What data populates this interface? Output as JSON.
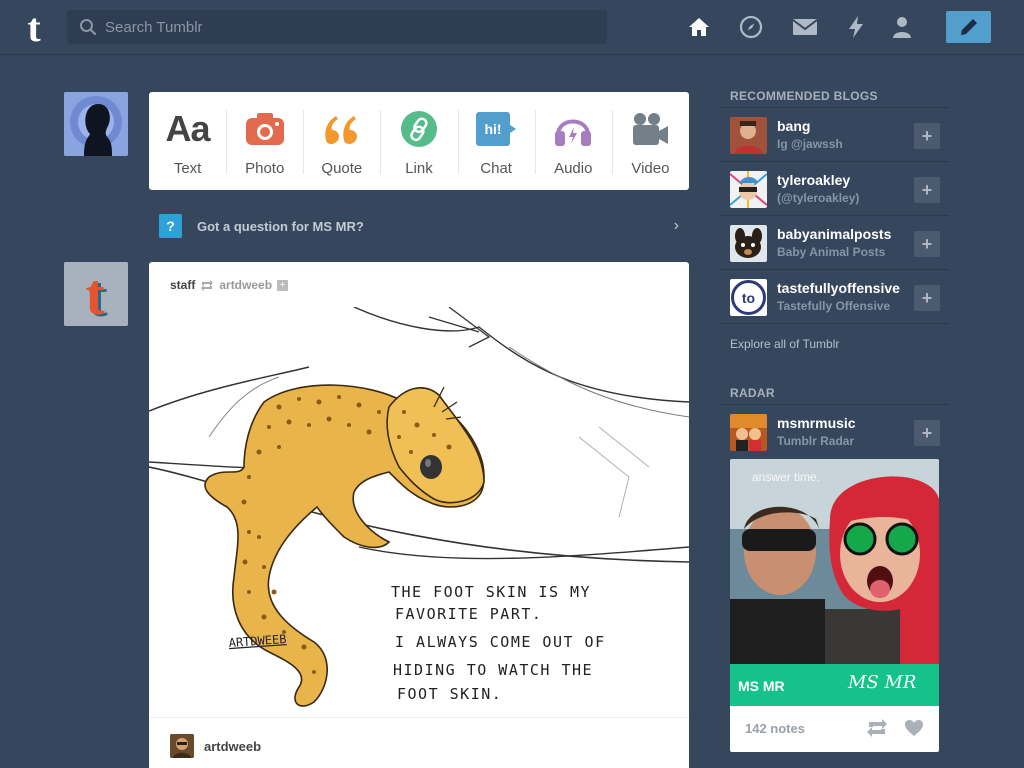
{
  "header": {
    "search_placeholder": "Search Tumblr",
    "nav": [
      "home-icon",
      "explore-compass-icon",
      "inbox-mail-icon",
      "activity-lightning-icon",
      "account-person-icon"
    ],
    "compose_color": "#529ecc"
  },
  "post_types": [
    {
      "label": "Text",
      "glyph": "Aa",
      "color": "#444444"
    },
    {
      "label": "Photo",
      "color": "#e46a4d"
    },
    {
      "label": "Quote",
      "glyph": "66",
      "color": "#f2992e"
    },
    {
      "label": "Link",
      "color": "#56bc8a"
    },
    {
      "label": "Chat",
      "glyph": "hi!",
      "color": "#529ecc"
    },
    {
      "label": "Audio",
      "color": "#a77dc2"
    },
    {
      "label": "Video",
      "color": "#748089"
    }
  ],
  "question": {
    "icon_glyph": "?",
    "text": "Got a question for MS MR?",
    "arrow": "›"
  },
  "post": {
    "author": "staff",
    "reblogged_from": "artdweeb",
    "plus": "+",
    "art_text": [
      "THE FOOT SKIN IS MY",
      "FAVORITE PART.",
      "I ALWAYS COME OUT OF",
      "HIDING TO WATCH THE",
      "FOOT SKIN."
    ],
    "art_signature": "ARTDWEEB",
    "footer_name": "artdweeb"
  },
  "sidebar": {
    "recommended_title": "RECOMMENDED BLOGS",
    "blogs": [
      {
        "name": "bang",
        "sub": "Ig @jawssh"
      },
      {
        "name": "tyleroakley",
        "sub": "(@tyleroakley)"
      },
      {
        "name": "babyanimalposts",
        "sub": "Baby Animal Posts"
      },
      {
        "name": "tastefullyoffensive",
        "sub": "Tastefully Offensive"
      }
    ],
    "add_label": "+",
    "explore": "Explore all of Tumblr",
    "radar_title": "RADAR",
    "radar_blog": {
      "name": "msmrmusic",
      "sub": "Tumblr Radar"
    },
    "radar_card": {
      "overlay": "answer time.",
      "band_text": "MS MR",
      "signature": "MS MR",
      "notes": "142 notes"
    }
  }
}
